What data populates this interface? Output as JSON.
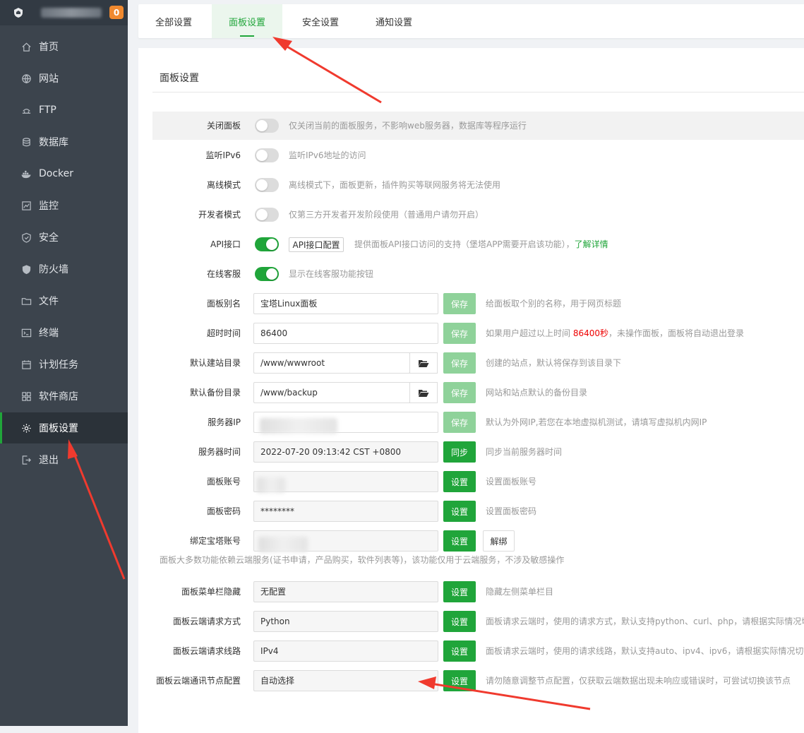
{
  "sidebar": {
    "badge": "0",
    "items": [
      {
        "label": "首页",
        "icon": "home-icon"
      },
      {
        "label": "网站",
        "icon": "globe-icon"
      },
      {
        "label": "FTP",
        "icon": "ftp-icon"
      },
      {
        "label": "数据库",
        "icon": "database-icon"
      },
      {
        "label": "Docker",
        "icon": "docker-icon"
      },
      {
        "label": "监控",
        "icon": "monitor-icon"
      },
      {
        "label": "安全",
        "icon": "shield-icon"
      },
      {
        "label": "防火墙",
        "icon": "firewall-icon"
      },
      {
        "label": "文件",
        "icon": "folder-icon"
      },
      {
        "label": "终端",
        "icon": "terminal-icon"
      },
      {
        "label": "计划任务",
        "icon": "calendar-icon"
      },
      {
        "label": "软件商店",
        "icon": "apps-icon"
      },
      {
        "label": "面板设置",
        "icon": "gear-icon",
        "active": true
      },
      {
        "label": "退出",
        "icon": "logout-icon"
      }
    ]
  },
  "tabs": [
    {
      "label": "全部设置"
    },
    {
      "label": "面板设置",
      "active": true
    },
    {
      "label": "安全设置"
    },
    {
      "label": "通知设置"
    }
  ],
  "panel": {
    "title": "面板设置",
    "close_panel": {
      "label": "关闭面板",
      "desc": "仅关闭当前的面板服务，不影响web服务器，数据库等程序运行",
      "on": false
    },
    "ipv6": {
      "label": "监听IPv6",
      "desc": "监听IPv6地址的访问",
      "on": false
    },
    "offline": {
      "label": "离线模式",
      "desc": "离线模式下，面板更新，插件购买等联网服务将无法使用",
      "on": false
    },
    "developer": {
      "label": "开发者模式",
      "desc": "仅第三方开发者开发阶段使用（普通用户请勿开启）",
      "on": false
    },
    "api": {
      "label": "API接口",
      "button": "API接口配置",
      "desc": "提供面板API接口访问的支持（堡塔APP需要开启该功能），",
      "link": "了解详情",
      "on": true
    },
    "online_service": {
      "label": "在线客服",
      "desc": "显示在线客服功能按钮",
      "on": true
    },
    "alias": {
      "label": "面板别名",
      "value": "宝塔Linux面板",
      "button": "保存",
      "desc": "给面板取个别的名称，用于网页标题"
    },
    "timeout": {
      "label": "超时时间",
      "value": "86400",
      "button": "保存",
      "desc_pre": "如果用户超过以上时间 ",
      "desc_red": "86400秒",
      "desc_post": "，未操作面板，面板将自动退出登录"
    },
    "site_dir": {
      "label": "默认建站目录",
      "value": "/www/wwwroot",
      "button": "保存",
      "desc": "创建的站点，默认将保存到该目录下"
    },
    "backup_dir": {
      "label": "默认备份目录",
      "value": "/www/backup",
      "button": "保存",
      "desc": "网站和站点默认的备份目录"
    },
    "server_ip": {
      "label": "服务器IP",
      "button": "保存",
      "desc": "默认为外网IP,若您在本地虚拟机测试，请填写虚拟机内网IP"
    },
    "server_time": {
      "label": "服务器时间",
      "value": "2022-07-20 09:13:42 CST +0800",
      "button": "同步",
      "desc": "同步当前服务器时间"
    },
    "account": {
      "label": "面板账号",
      "button": "设置",
      "desc": "设置面板账号"
    },
    "password": {
      "label": "面板密码",
      "value": "********",
      "button": "设置",
      "desc": "设置面板密码"
    },
    "bind": {
      "label": "绑定宝塔账号",
      "button": "设置",
      "unbind": "解绑"
    },
    "cloud_note": "面板大多数功能依赖云端服务(证书申请，产品购买，软件列表等)，该功能仅用于云端服务，不涉及敏感操作",
    "menu_hide": {
      "label": "面板菜单栏隐藏",
      "value": "无配置",
      "button": "设置",
      "desc": "隐藏左侧菜单栏目"
    },
    "req_method": {
      "label": "面板云端请求方式",
      "value": "Python",
      "button": "设置",
      "desc": "面板请求云端时，使用的请求方式，默认支持python、curl、php，请根据实际情况切换"
    },
    "req_line": {
      "label": "面板云端请求线路",
      "value": "IPv4",
      "button": "设置",
      "desc": "面板请求云端时，使用的请求线路，默认支持auto、ipv4、ipv6，请根据实际情况切换"
    },
    "node": {
      "label": "面板云端通讯节点配置",
      "value": "自动选择",
      "button": "设置",
      "desc": "请勿随意调整节点配置，仅获取云端数据出现未响应或错误时，可尝试切换该节点"
    }
  },
  "colors": {
    "accent": "#20a53a",
    "sidebar_bg": "#3c444d",
    "annotation_arrow": "#f03a2e"
  }
}
